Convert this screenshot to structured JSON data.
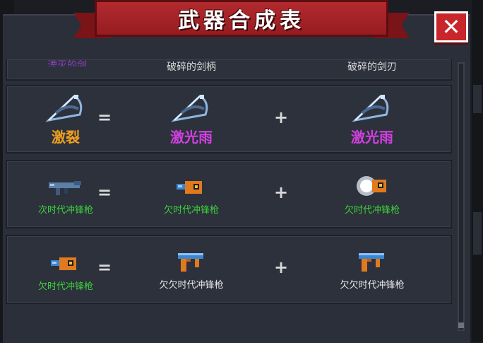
{
  "title": "武器合成表",
  "close_label": "✕",
  "partial_row": {
    "result_label": "湮灭的剑",
    "part1_label": "破碎的剑柄",
    "part2_label": "破碎的剑刃"
  },
  "recipes": [
    {
      "result": {
        "label": "激裂",
        "color": "#f0a020",
        "icon": "bow-icon"
      },
      "equals": "=",
      "part1": {
        "label": "激光雨",
        "color": "#d040e0",
        "icon": "bow-icon"
      },
      "plus": "+",
      "part2": {
        "label": "激光雨",
        "color": "#d040e0",
        "icon": "bow-icon"
      }
    },
    {
      "result": {
        "label": "次时代冲锋枪",
        "color": "#3cd43c",
        "icon": "smg-icon"
      },
      "equals": "=",
      "part1": {
        "label": "欠时代冲锋枪",
        "color": "#3cd43c",
        "icon": "blaster-icon"
      },
      "plus": "+",
      "part2": {
        "label": "欠时代冲锋枪",
        "color": "#3cd43c",
        "icon": "glowing-blaster-icon"
      }
    },
    {
      "result": {
        "label": "欠时代冲锋枪",
        "color": "#3cd43c",
        "icon": "blaster-icon"
      },
      "equals": "=",
      "part1": {
        "label": "欠欠时代冲锋枪",
        "color": "#e8e8e8",
        "icon": "pistol-icon"
      },
      "plus": "+",
      "part2": {
        "label": "欠欠时代冲锋枪",
        "color": "#e8e8e8",
        "icon": "pistol-icon"
      }
    }
  ],
  "colors": {
    "banner": "#a8252a",
    "panel": "#2b2f39",
    "close": "#c8262a"
  }
}
